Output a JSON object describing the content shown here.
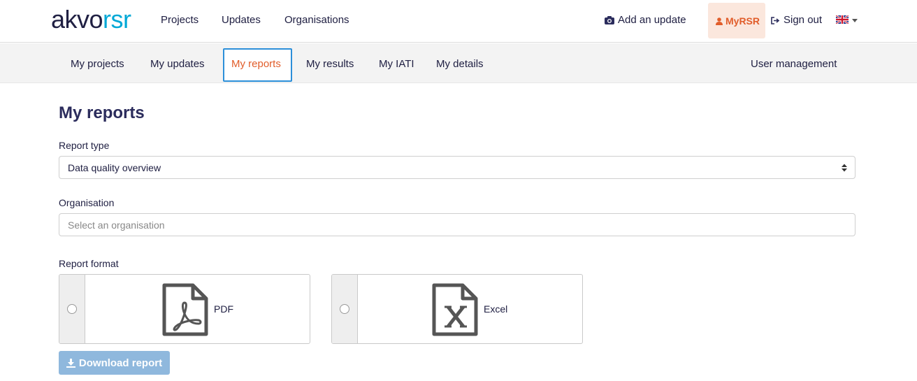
{
  "header": {
    "logo_part1": "akvo",
    "logo_part2": "rsr",
    "nav": [
      "Projects",
      "Updates",
      "Organisations"
    ],
    "add_update": "Add an update",
    "myrsr": "MyRSR",
    "sign_out": "Sign out",
    "language_icon": "uk-flag-icon"
  },
  "subnav": {
    "items": [
      "My projects",
      "My updates",
      "My reports",
      "My results",
      "My IATI",
      "My details"
    ],
    "active": "My reports",
    "user_management": "User management"
  },
  "main": {
    "title": "My reports",
    "report_type_label": "Report type",
    "report_type_value": "Data quality overview",
    "organisation_label": "Organisation",
    "organisation_placeholder": "Select an organisation",
    "report_format_label": "Report format",
    "formats": [
      {
        "label": "PDF",
        "icon": "pdf-file-icon"
      },
      {
        "label": "Excel",
        "icon": "excel-file-icon"
      }
    ],
    "download_label": "Download report"
  },
  "colors": {
    "accent": "#e15d2a",
    "active_border": "#2c8fd9",
    "primary_text": "#202043",
    "download_btn": "#8fb8dd"
  }
}
